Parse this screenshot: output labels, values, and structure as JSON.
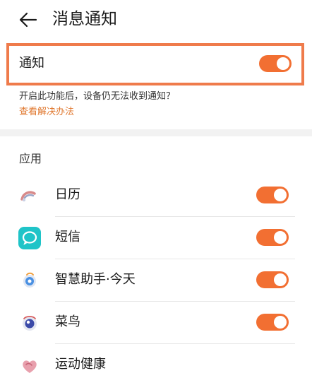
{
  "header": {
    "title": "消息通知"
  },
  "notify": {
    "label": "通知",
    "enabled": true
  },
  "hint": {
    "text": "开启此功能后，设备仍无法收到通知？",
    "link": "查看解决办法"
  },
  "section": {
    "title": "应用"
  },
  "apps": [
    {
      "name": "日历",
      "icon": "calendar-icon",
      "enabled": true
    },
    {
      "name": "短信",
      "icon": "message-icon",
      "enabled": true
    },
    {
      "name": "智慧助手·今天",
      "icon": "assistant-icon",
      "enabled": true
    },
    {
      "name": "菜鸟",
      "icon": "cainiao-icon",
      "enabled": true
    },
    {
      "name": "运动健康",
      "icon": "health-icon",
      "enabled": false
    }
  ],
  "colors": {
    "accent": "#f26f32",
    "highlight_border": "#ef7b4b",
    "link": "#e0782f"
  }
}
